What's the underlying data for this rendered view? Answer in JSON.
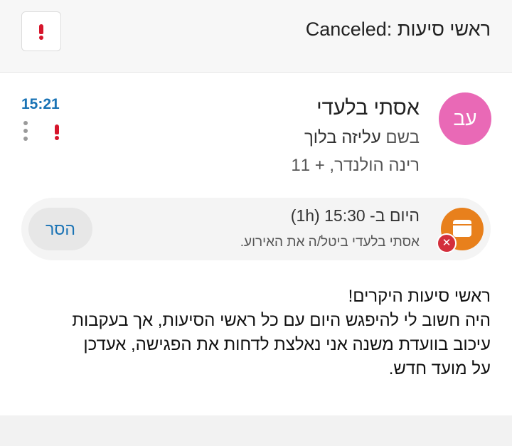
{
  "header": {
    "title": "Canceled: ראשי סיעות",
    "flag_icon": "exclamation-icon"
  },
  "message": {
    "avatar_initials": "עב",
    "avatar_color": "#e969b6",
    "sender": "אסתי בלעדי",
    "on_behalf_prefix": "בשם",
    "on_behalf_name": "עליזה בלוך",
    "recipients": "רינה הולנדר, + 11",
    "time": "15:21",
    "time_color": "#1a73b5",
    "flag_color": "#d6152b"
  },
  "event": {
    "when": "היום ב- 15:30 (1h)",
    "note": "אסתי בלעדי ביטל/ה את האירוע.",
    "remove_label": "הסר",
    "icon": "calendar-icon",
    "icon_color": "#e8801c",
    "badge_icon": "close-icon",
    "badge_color": "#d32f3c"
  },
  "body": {
    "lines": [
      "ראשי סיעות היקרים!",
      "היה חשוב לי להיפגש היום עם כל ראשי הסיעות, אך בעקבות",
      "עיכוב בוועדת משנה אני נאלצת לדחות את הפגישה, אעדכן",
      "על מועד חדש."
    ]
  }
}
